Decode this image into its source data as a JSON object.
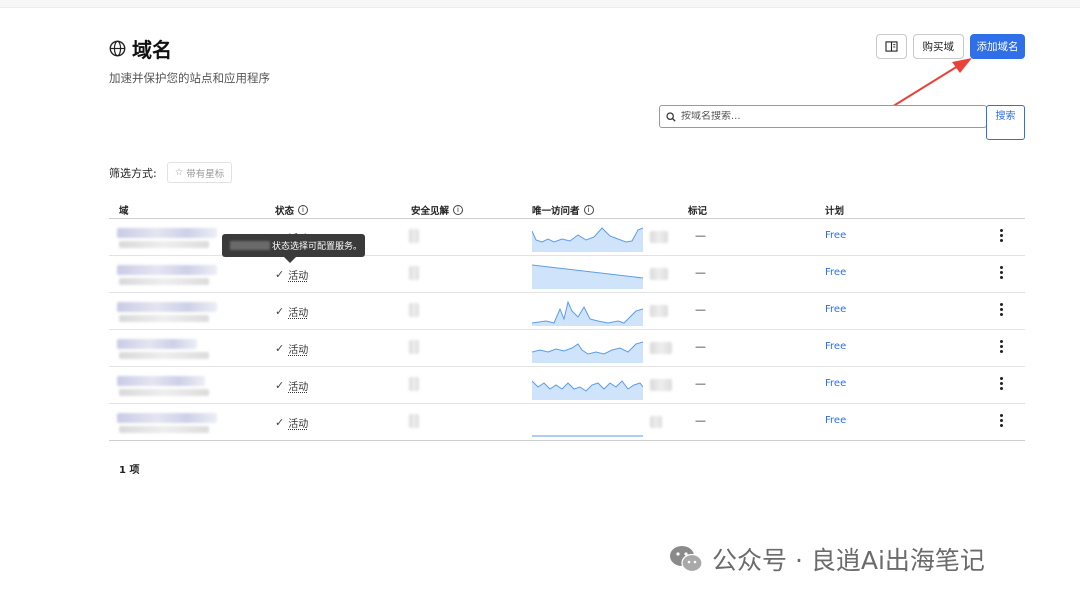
{
  "header": {
    "title": "域名",
    "subtitle": "加速并保护您的站点和应用程序",
    "buy_label": "购买域",
    "add_label": "添加域名"
  },
  "search": {
    "placeholder": "按域名搜索...",
    "button_label": "搜索"
  },
  "filter": {
    "label": "筛选方式:",
    "starred_label": "带有星标"
  },
  "table": {
    "columns": [
      "域",
      "状态",
      "安全见解",
      "唯一访问者",
      "标记",
      "计划"
    ],
    "rows": [
      {
        "status": "活动",
        "tag": "—",
        "plan": "Free"
      },
      {
        "status": "活动",
        "tag": "—",
        "plan": "Free"
      },
      {
        "status": "活动",
        "tag": "—",
        "plan": "Free"
      },
      {
        "status": "活动",
        "tag": "—",
        "plan": "Free"
      },
      {
        "status": "活动",
        "tag": "—",
        "plan": "Free"
      },
      {
        "status": "活动",
        "tag": "—",
        "plan": "Free"
      }
    ]
  },
  "tooltip": {
    "text": "状态选择可配置服务。"
  },
  "footer": {
    "count": "1 项"
  },
  "watermark": {
    "text": "公众号 · 良逍Ai出海笔记"
  },
  "icons": [
    "globe-icon",
    "book-icon",
    "search-icon",
    "star-icon",
    "info-icon",
    "check-icon",
    "kebab-icon",
    "wechat-icon"
  ],
  "colors": {
    "accent": "#2f6fe8",
    "arrow": "#e8423a",
    "sparkline_fill": "#cfe3fb",
    "sparkline_stroke": "#5b9ee9"
  }
}
